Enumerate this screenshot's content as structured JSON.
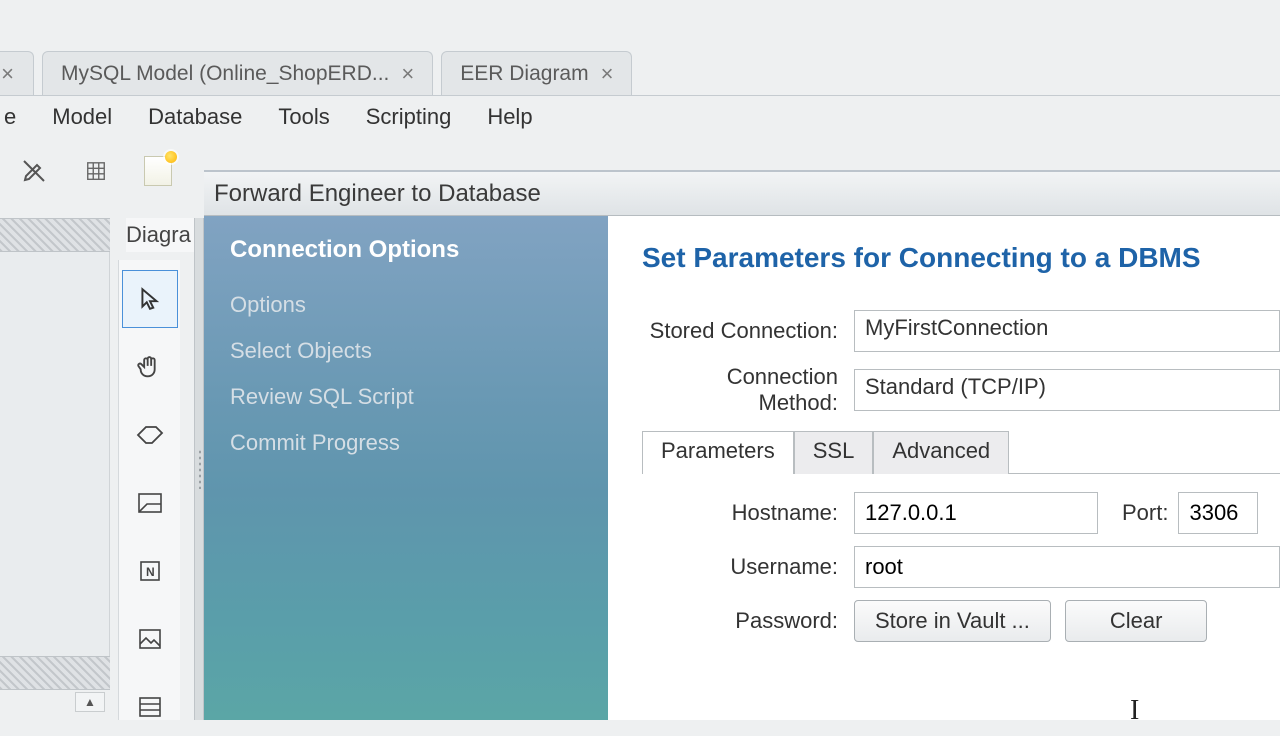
{
  "tabs": {
    "first_close": "×",
    "model": {
      "label": "MySQL Model (Online_ShopERD...",
      "close": "×"
    },
    "eer": {
      "label": "EER Diagram",
      "close": "×"
    }
  },
  "menubar": {
    "m0": "e",
    "m1": "Model",
    "m2": "Database",
    "m3": "Tools",
    "m4": "Scripting",
    "m5": "Help"
  },
  "side": {
    "diagra": "Diagra"
  },
  "dialog": {
    "title": "Forward Engineer to Database",
    "wizard": {
      "s0": "Connection Options",
      "s1": "Options",
      "s2": "Select Objects",
      "s3": "Review SQL Script",
      "s4": "Commit Progress"
    },
    "heading": "Set Parameters for Connecting to a DBMS",
    "labels": {
      "stored": "Stored Connection:",
      "method": "Connection Method:",
      "hostname": "Hostname:",
      "port": "Port:",
      "username": "Username:",
      "password": "Password:"
    },
    "fields": {
      "stored_connection": "MyFirstConnection",
      "connection_method": "Standard (TCP/IP)",
      "hostname": "127.0.0.1",
      "port": "3306",
      "username": "root"
    },
    "subtabs": {
      "t0": "Parameters",
      "t1": "SSL",
      "t2": "Advanced"
    },
    "buttons": {
      "store": "Store in Vault ...",
      "clear": "Clear"
    }
  },
  "toggle_arrow": "▲"
}
